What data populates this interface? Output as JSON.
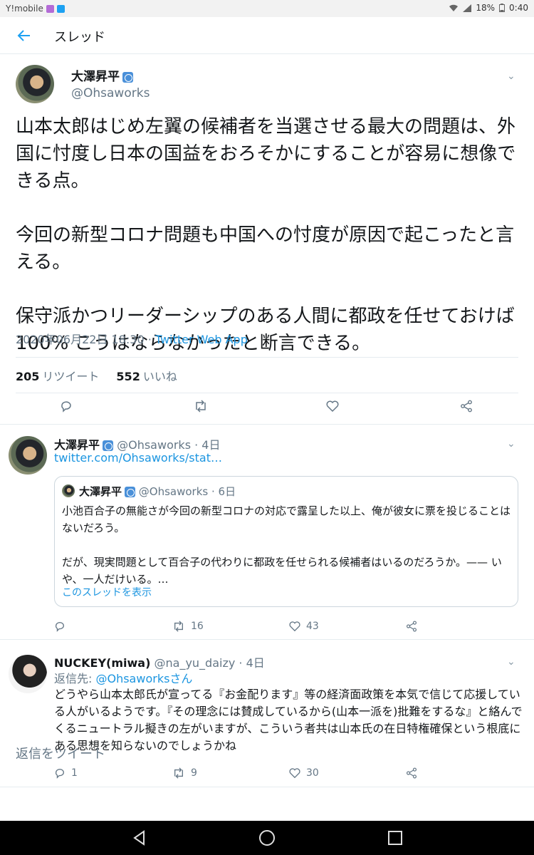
{
  "status_bar": {
    "carrier": "Y!mobile",
    "battery": "18%",
    "time": "0:40"
  },
  "header": {
    "title": "スレッド"
  },
  "main_tweet": {
    "name": "大澤昇平",
    "handle": "@Ohsaworks",
    "text": "山本太郎はじめ左翼の候補者を当選させる最大の問題は、外国に忖度し日本の国益をおろそかにすることが容易に想像できる点。\n\n今回の新型コロナ問題も中国への忖度が原因で起こったと言える。\n\n保守派かつリーダーシップのある人間に都政を任せておけば 100% こうはならなかったと断言できる。",
    "timestamp": "2020年06月22日 18:30 · ",
    "app": "Twitter Web App",
    "retweets": "205",
    "retweets_label": "リツイート",
    "likes": "552",
    "likes_label": "いいね"
  },
  "reply_1": {
    "name": "大澤昇平",
    "handle_time": " @Ohsaworks · 4日",
    "link": "twitter.com/Ohsaworks/stat…",
    "quote": {
      "name": "大澤昇平",
      "handle_time": " @Ohsaworks · 6日",
      "text": "小池百合子の無能さが今回の新型コロナの対応で露呈した以上、俺が彼女に票を投じることはないだろう。\n\nだが、現実問題として百合子の代わりに都政を任せられる候補者はいるのだろうか。—— いや、一人だけいる。…",
      "show_thread": "このスレッドを表示"
    },
    "actions": {
      "replies": "",
      "retweets": "16",
      "likes": "43"
    }
  },
  "reply_2": {
    "name": "NUCKEY(miwa)",
    "handle_time": " @na_yu_daizy · 4日",
    "reply_prefix": "返信先: ",
    "reply_to": "@Ohsaworksさん",
    "text": "どうやら山本太郎氏が宣ってる『お金配ります』等の経済面政策を本気で信じて応援している人がいるようです。『その理念には賛成しているから(山本一派を)批難をするな』と絡んでくるニュートラル擬きの左がいますが、こういう者共は山本氏の在日特権確保という根底にある思想を知らないのでしょうかね",
    "actions": {
      "replies": "1",
      "retweets": "9",
      "likes": "30"
    }
  },
  "reply_bar": {
    "placeholder": "返信をツイート"
  },
  "colors": {
    "link": "#1b95e0",
    "muted": "#657786",
    "verified": "#4a90d9"
  }
}
